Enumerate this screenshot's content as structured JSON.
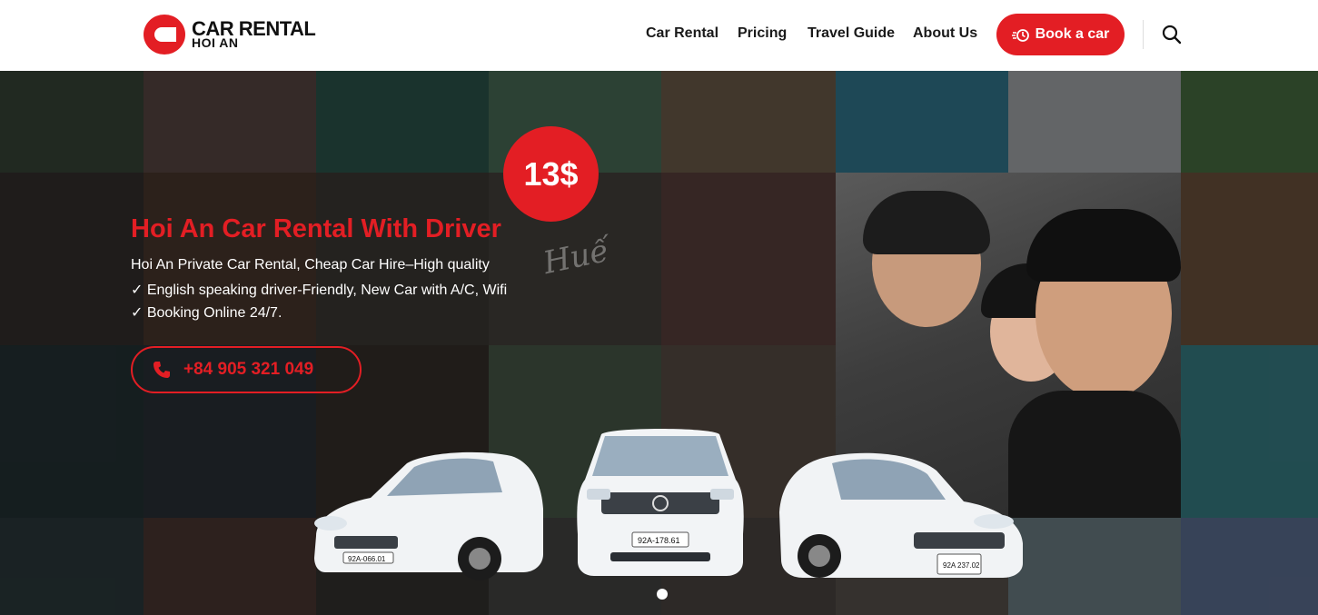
{
  "brand": {
    "line1": "CAR RENTAL",
    "line2": "HOI AN",
    "accent": "#e31e24"
  },
  "nav": {
    "items": [
      {
        "label": "Car Rental"
      },
      {
        "label": "Pricing"
      },
      {
        "label": "Travel Guide"
      },
      {
        "label": "About Us"
      }
    ],
    "book_label": "Book a car",
    "book_icon": "fast-car-icon",
    "search_icon": "search-icon"
  },
  "hero": {
    "price": "13$",
    "title": "Hoi An Car Rental With Driver",
    "lines": [
      "Hoi An Private Car Rental, Cheap Car Hire–High quality",
      "✓ English speaking driver-Friendly, New Car with A/C, Wifi",
      "✓ Booking Online 24/7."
    ],
    "phone": "+84 905 321 049",
    "phone_icon": "phone-icon",
    "background_text": "Huế",
    "plates": [
      "92A-066.01",
      "92A-178.61",
      "92A 237.02"
    ],
    "slider_dots": 1
  }
}
